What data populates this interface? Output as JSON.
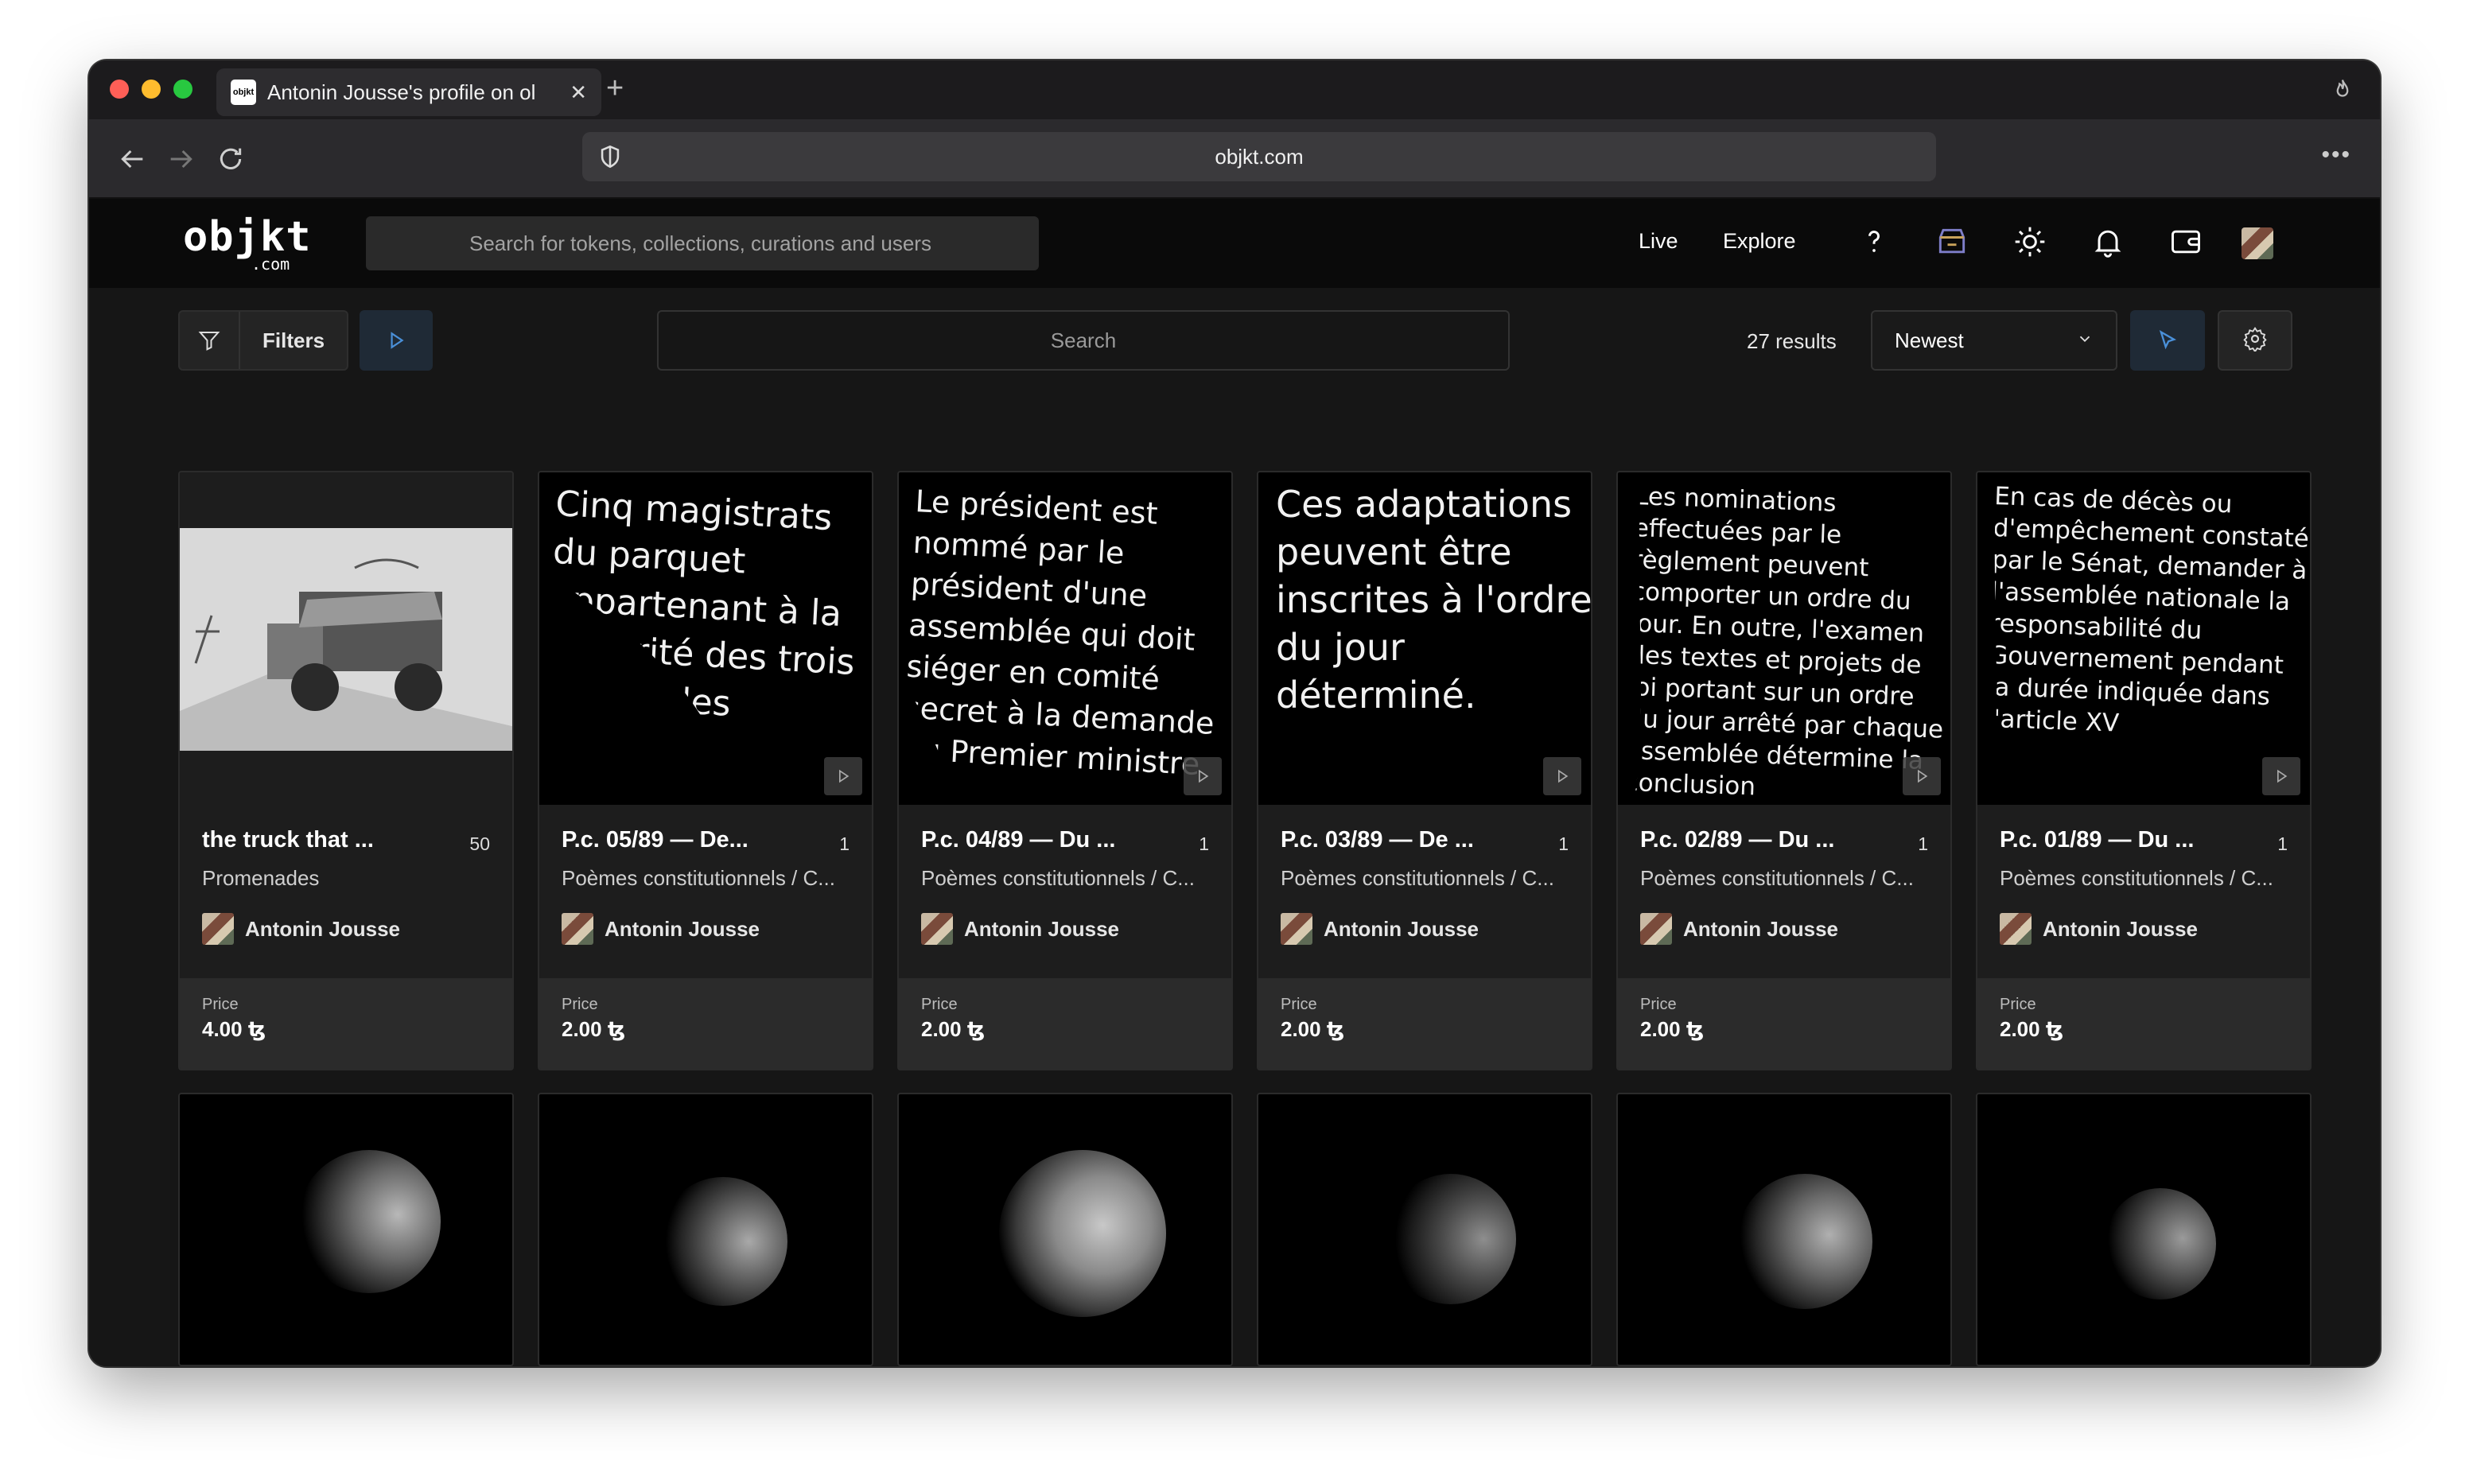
{
  "browser": {
    "tab_title": "Antonin Jousse's profile on ol",
    "tab_favicon": "objkt",
    "url": "objkt.com"
  },
  "site": {
    "logo_main": "objkt",
    "logo_sub": ".com",
    "search_placeholder": "Search for tokens, collections, curations and users",
    "nav": [
      "Live",
      "Explore"
    ],
    "header_icons": [
      "help-icon",
      "marketplace-icon",
      "theme-sun-icon",
      "bell-icon",
      "wallet-icon",
      "user-avatar"
    ]
  },
  "toolbar": {
    "filters_label": "Filters",
    "search_placeholder": "Search",
    "results": "27 results",
    "sort": "Newest"
  },
  "cards": [
    {
      "title": "the truck that ...",
      "edition": "50",
      "collection": "Promenades",
      "artist": "Antonin Jousse",
      "price_label": "Price",
      "price": "4.00 ꜩ"
    },
    {
      "title": "P.c. 05/89 — De...",
      "edition": "1",
      "collection": "Poèmes constitutionnels / C...",
      "artist": "Antonin Jousse",
      "price_label": "Price",
      "price": "2.00 ꜩ"
    },
    {
      "title": "P.c. 04/89 — Du ...",
      "edition": "1",
      "collection": "Poèmes constitutionnels / C...",
      "artist": "Antonin Jousse",
      "price_label": "Price",
      "price": "2.00 ꜩ"
    },
    {
      "title": "P.c. 03/89 — De ...",
      "edition": "1",
      "collection": "Poèmes constitutionnels / C...",
      "artist": "Antonin Jousse",
      "price_label": "Price",
      "price": "2.00 ꜩ"
    },
    {
      "title": "P.c. 02/89 — Du ...",
      "edition": "1",
      "collection": "Poèmes constitutionnels / C...",
      "artist": "Antonin Jousse",
      "price_label": "Price",
      "price": "2.00 ꜩ"
    },
    {
      "title": "P.c. 01/89 — Du ...",
      "edition": "1",
      "collection": "Poèmes constitutionnels / C...",
      "artist": "Antonin Jousse",
      "price_label": "Price",
      "price": "2.00 ꜩ"
    }
  ],
  "poems": [
    "Cinq magistrats du parquet appartenant à la majorité des trois quarts des",
    "Le président est nommé par le président d'une assemblée qui doit siéger en comité secret à la demande du Premier ministre",
    "Ces adaptations peuvent être inscrites à l'ordre du jour déterminé.",
    "Les nominations effectuées par le règlement peuvent comporter un ordre du jour. En outre, l'examen des textes et projets de loi portant sur un ordre du jour arrêté par chaque assemblée détermine la conclusion",
    "En cas de décès ou d'empêchement constaté par le Sénat, demander à l'assemblée nationale la responsabilité du Gouvernement pendant la durée indiquée dans l'article XV"
  ]
}
